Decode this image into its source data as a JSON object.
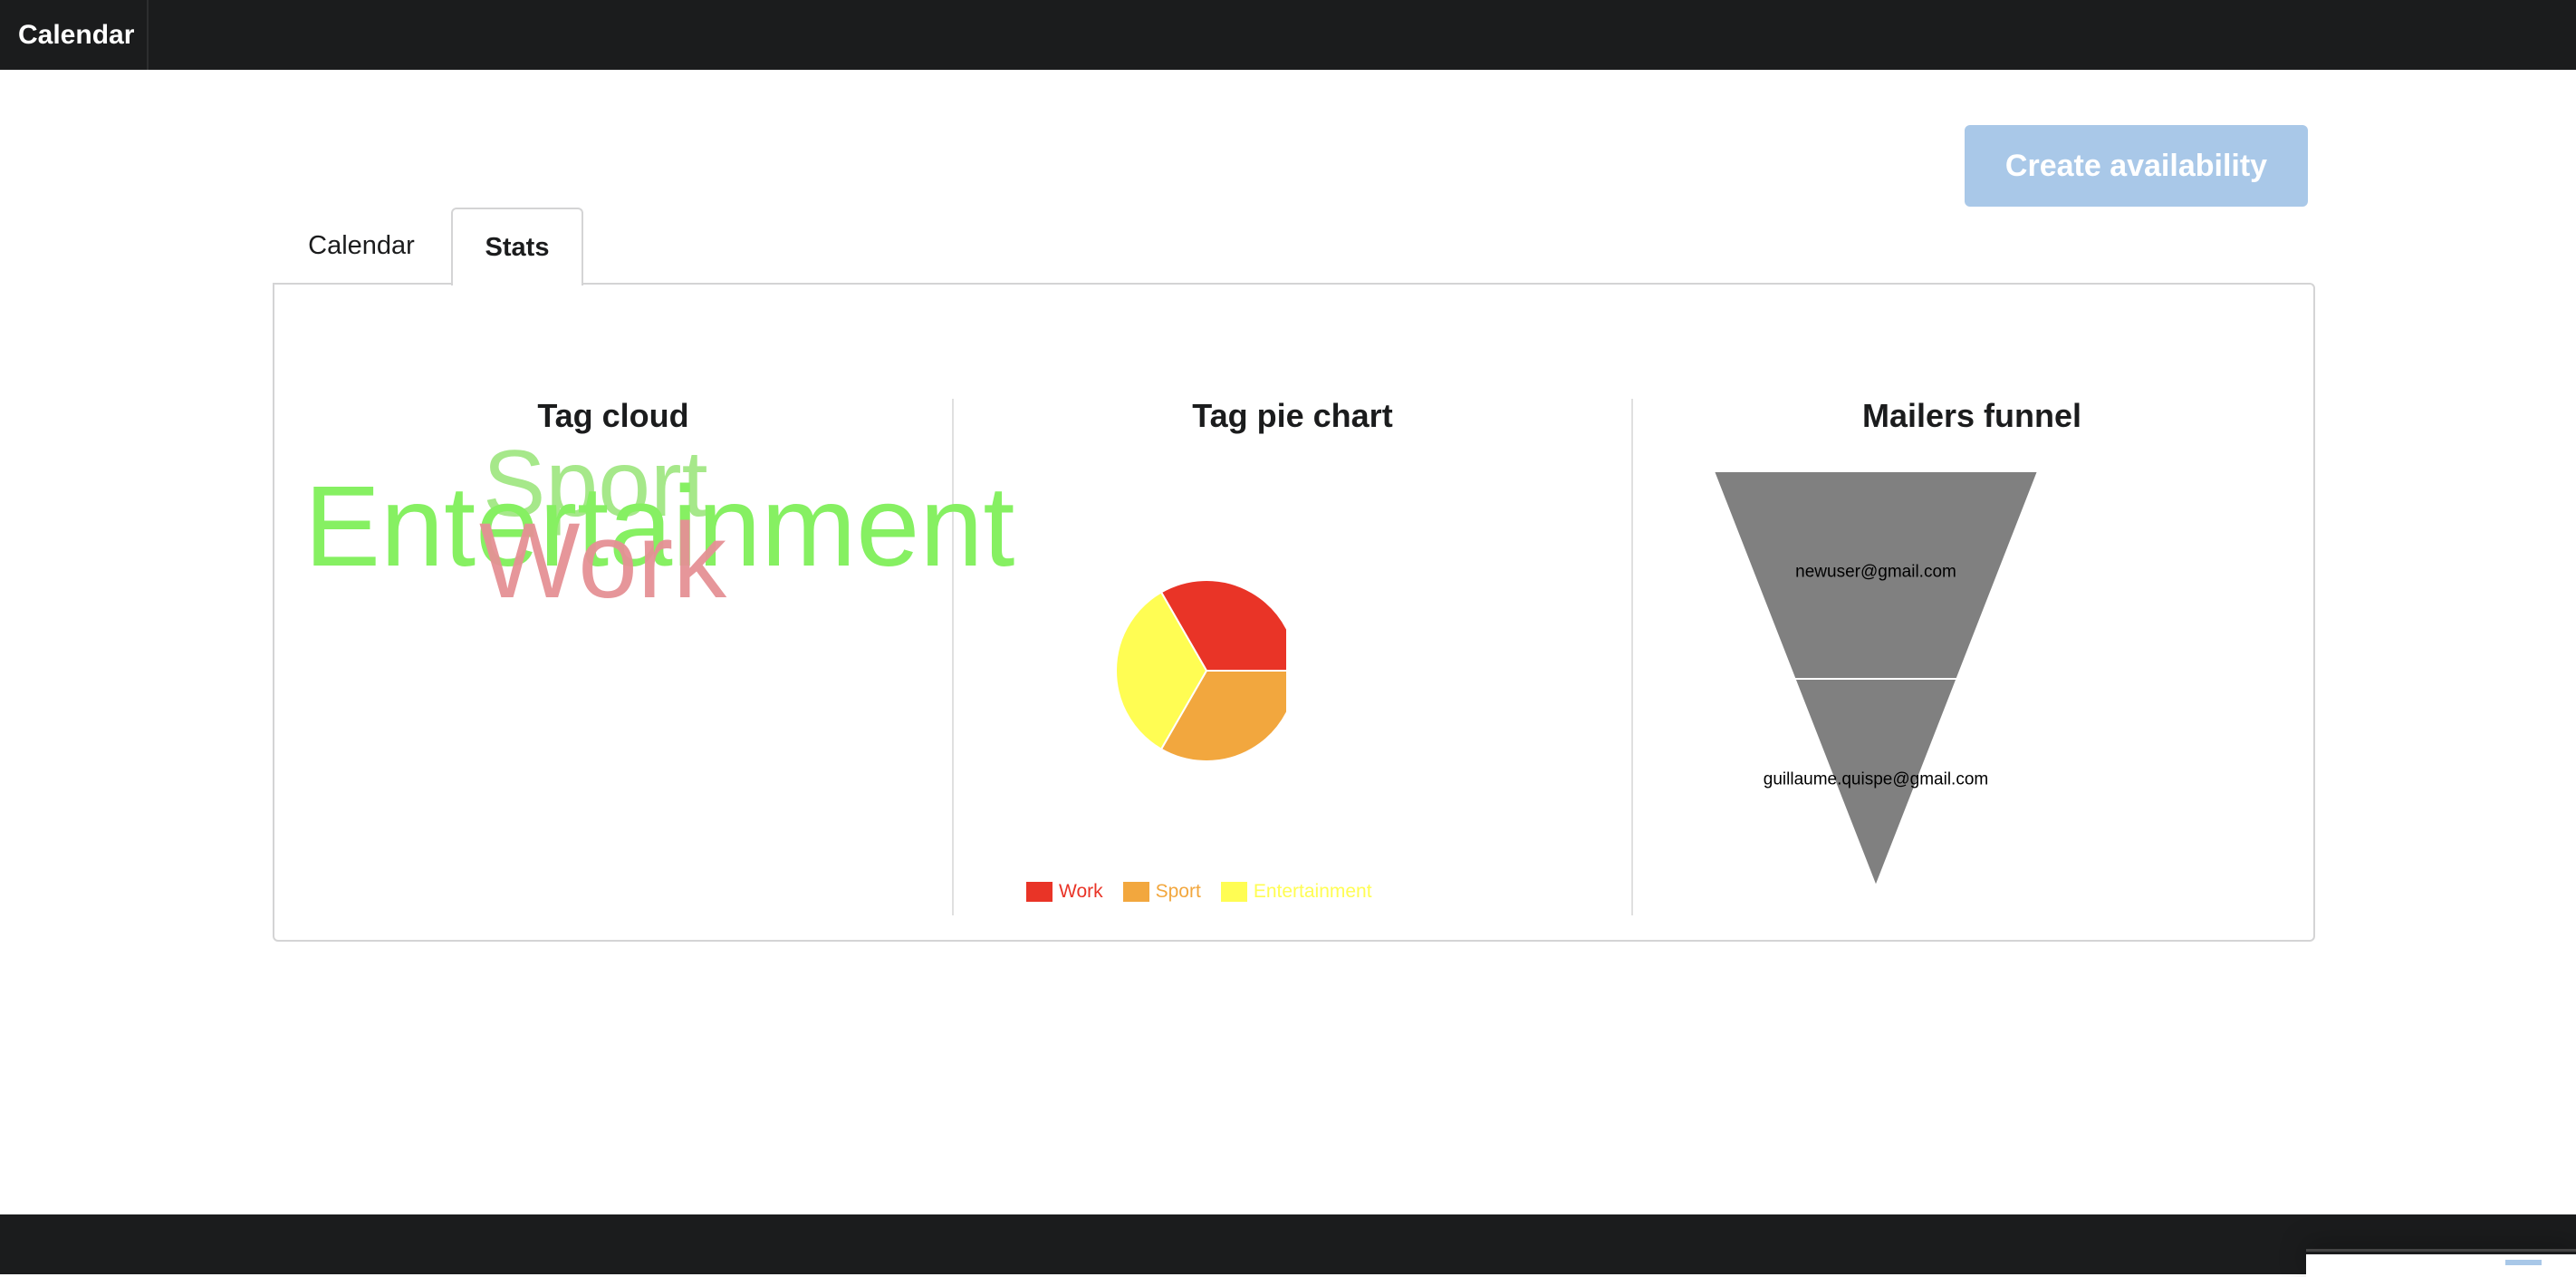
{
  "app": {
    "brand": "Calendar"
  },
  "actions": {
    "create_label": "Create availability"
  },
  "tabs": [
    {
      "label": "Calendar",
      "active": false
    },
    {
      "label": "Stats",
      "active": true
    }
  ],
  "sections": {
    "tag_cloud_title": "Tag cloud",
    "pie_title": "Tag pie chart",
    "funnel_title": "Mailers funnel"
  },
  "tag_cloud": {
    "words": [
      {
        "text": "Sport",
        "color": "#a6e88a"
      },
      {
        "text": "Entertainment",
        "color": "#86f062"
      },
      {
        "text": "Work",
        "color": "#e59195"
      }
    ]
  },
  "chart_data": [
    {
      "type": "pie",
      "title": "Tag pie chart",
      "categories": [
        "Work",
        "Sport",
        "Entertainment"
      ],
      "values": [
        1,
        1,
        1
      ],
      "colors": [
        "#e93427",
        "#f2a73e",
        "#fffd53"
      ],
      "legend": "bottom"
    },
    {
      "type": "funnel",
      "title": "Mailers funnel",
      "categories": [
        "newuser@gmail.com",
        "guillaume.quispe@gmail.com"
      ],
      "values": [
        1,
        1
      ],
      "colors": [
        "#808080"
      ]
    }
  ]
}
